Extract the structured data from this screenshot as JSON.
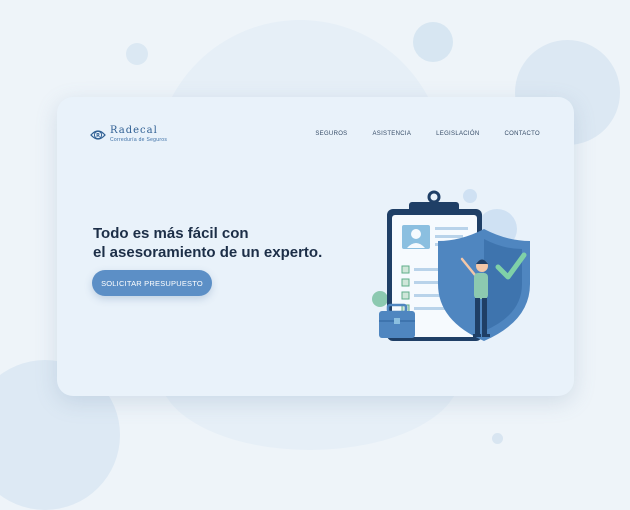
{
  "logo": {
    "name": "Radecal",
    "subtitle": "Correduría de Seguros"
  },
  "nav": {
    "items": [
      {
        "label": "SEGUROS"
      },
      {
        "label": "ASISTENCIA"
      },
      {
        "label": "LEGISLACIÓN"
      },
      {
        "label": "CONTACTO"
      }
    ]
  },
  "hero": {
    "headline_line1": "Todo es más fácil con",
    "headline_line2": "el asesoramiento de un experto.",
    "cta_label": "SOLICITAR PRESUPUESTO"
  },
  "colors": {
    "page_background": "#eef4f9",
    "card_background": "#e9f2fa",
    "accent": "#5c8fc6",
    "heading": "#1c2e47",
    "brand": "#2f5f93"
  },
  "icons": [
    "logo-mark",
    "clipboard-illustration",
    "shield-check-illustration",
    "person-illustration",
    "briefcase-illustration"
  ]
}
